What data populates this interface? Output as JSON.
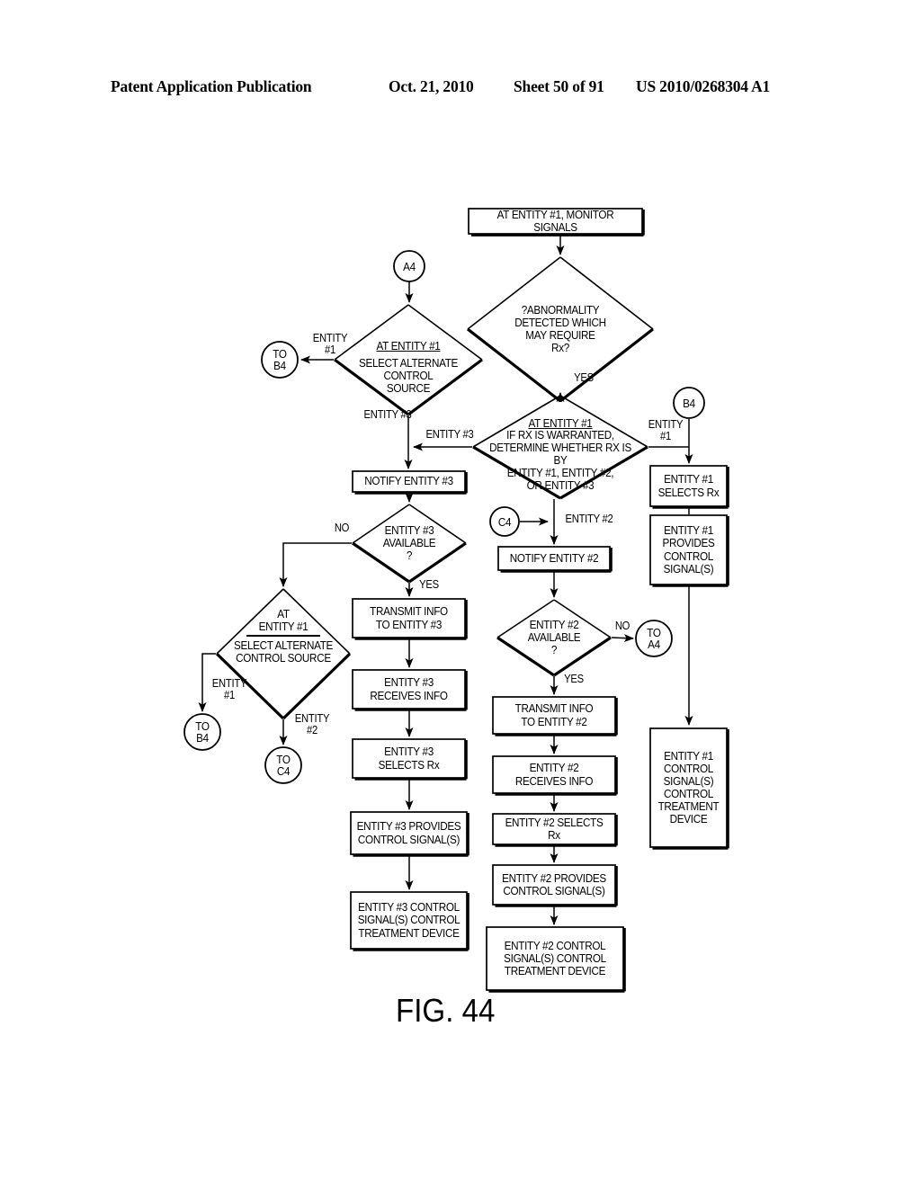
{
  "header": {
    "publication": "Patent Application Publication",
    "date": "Oct. 21, 2010",
    "sheet": "Sheet 50 of 91",
    "patent_number": "US 2010/0268304 A1"
  },
  "figure": {
    "caption": "FIG. 44",
    "type": "flowchart"
  },
  "nodes": {
    "monitor_signals": "AT ENTITY #1, MONITOR SIGNALS",
    "abnormality_decision": "?ABNORMALITY\nDETECTED WHICH\nMAY REQUIRE\nRx?",
    "conn_a4_top": "A4",
    "alt_control_top_line1": "AT ENTITY #1",
    "alt_control_top_rest": "SELECT ALTERNATE\nCONTROL\nSOURCE",
    "conn_to_b4_upper": "TO\nB4",
    "rx_determine_line1": "AT ENTITY #1",
    "rx_determine_rest": "IF RX IS WARRANTED,\nDETERMINE WHETHER RX IS BY\nENTITY #1, ENTITY #2,\nOR ENTITY #3",
    "conn_b4_right": "B4",
    "notify_entity3": "NOTIFY ENTITY #3",
    "entity3_available": "ENTITY #3\nAVAILABLE\n?",
    "alt_control_low_line1": "AT\nENTITY #1",
    "alt_control_low_rest": "SELECT ALTERNATE\nCONTROL SOURCE",
    "conn_to_b4_lower": "TO\nB4",
    "conn_to_c4_lower": "TO\nC4",
    "transmit_info_e3": "TRANSMIT INFO\nTO ENTITY #3",
    "entity3_receives": "ENTITY #3\nRECEIVES INFO",
    "entity3_selects": "ENTITY #3\nSELECTS Rx",
    "entity3_provides": "ENTITY #3 PROVIDES\nCONTROL SIGNAL(S)",
    "entity3_control_dev": "ENTITY #3 CONTROL\nSIGNAL(S) CONTROL\nTREATMENT DEVICE",
    "conn_c4_mid": "C4",
    "notify_entity2": "NOTIFY ENTITY #2",
    "entity2_available": "ENTITY #2\nAVAILABLE\n?",
    "conn_to_a4_right": "TO\nA4",
    "transmit_info_e2": "TRANSMIT INFO\nTO ENTITY #2",
    "entity2_receives": "ENTITY #2\nRECEIVES INFO",
    "entity2_selects": "ENTITY #2 SELECTS Rx",
    "entity2_provides": "ENTITY #2 PROVIDES\nCONTROL SIGNAL(S)",
    "entity2_control_dev": "ENTITY #2 CONTROL\nSIGNAL(S) CONTROL\nTREATMENT DEVICE",
    "entity1_selects": "ENTITY #1\nSELECTS Rx",
    "entity1_provides": "ENTITY #1\nPROVIDES\nCONTROL\nSIGNAL(S)",
    "entity1_control_dev": "ENTITY #1\nCONTROL\nSIGNAL(S)\nCONTROL\nTREATMENT\nDEVICE"
  },
  "edge_labels": {
    "yes_abnormality": "YES",
    "entity1_to_b4_upper": "ENTITY\n#1",
    "entity3_from_alt": "ENTITY #3",
    "entity3_from_rx": "ENTITY #3",
    "entity1_from_rx": "ENTITY\n#1",
    "entity2_from_rx": "ENTITY #2",
    "no_entity3": "NO",
    "yes_entity3": "YES",
    "entity1_low": "ENTITY\n#1",
    "entity2_low": "ENTITY\n#2",
    "no_entity2": "NO",
    "yes_entity2": "YES"
  },
  "colors": {
    "ink": "#000000",
    "page": "#ffffff"
  }
}
